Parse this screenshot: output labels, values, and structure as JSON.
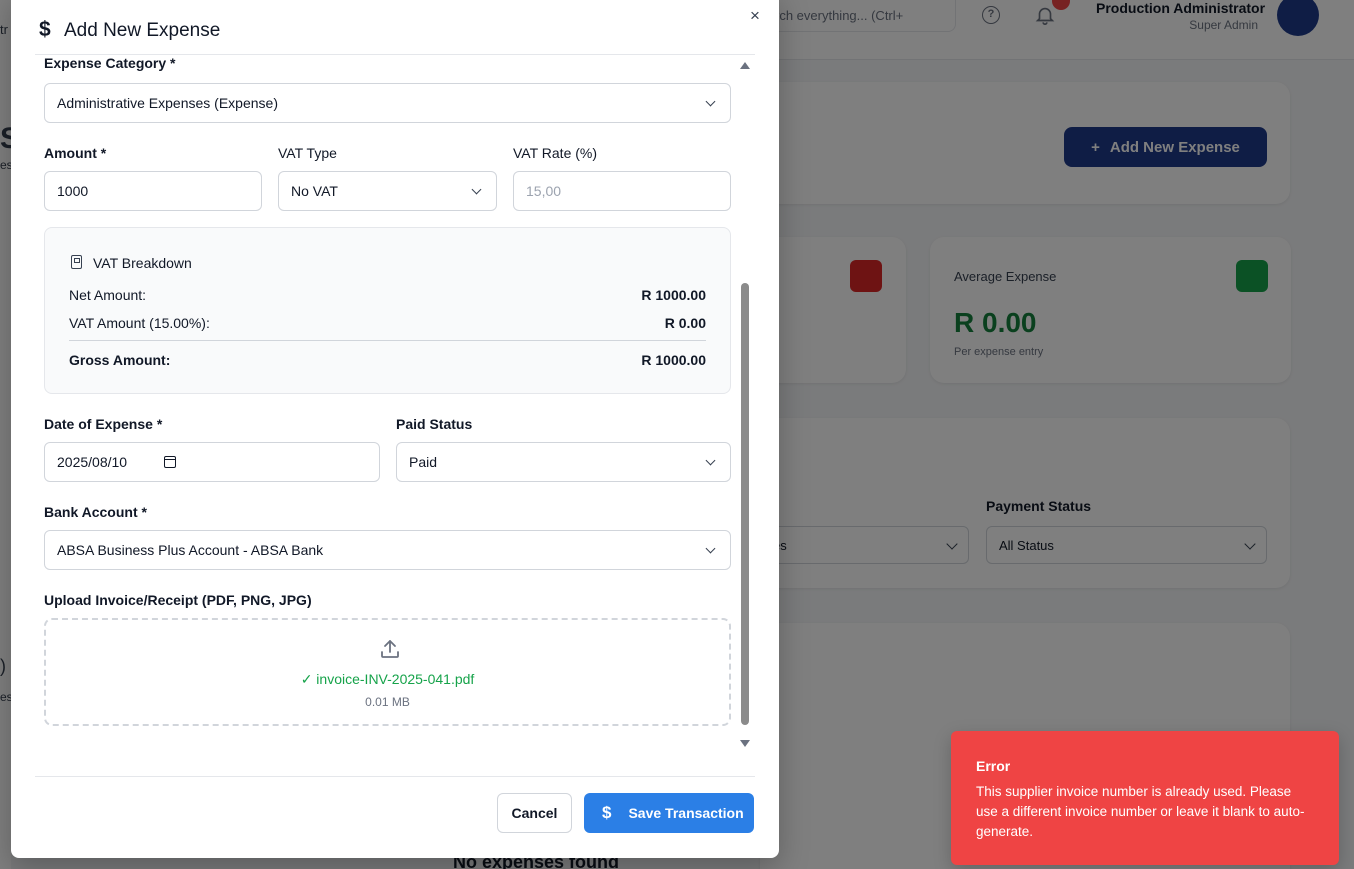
{
  "background": {
    "left_text_top": "tr",
    "left_text_mid": "S",
    "left_text_mid2": "es",
    "left_text_low": ")",
    "left_text_low2": "es",
    "search_placeholder": "rch everything... (Ctrl+",
    "user_name": "Production Administrator",
    "user_role": "Super Admin",
    "add_button_label": "Add New Expense",
    "stat_average_label": "Average Expense",
    "stat_average_value": "R 0.00",
    "stat_average_sub": "Per expense entry",
    "payment_status_label": "Payment Status",
    "payment_status_value": "All Status",
    "category_filter_value": "es",
    "empty_state": "No expenses found"
  },
  "modal": {
    "title": "Add New Expense",
    "close_label": "×",
    "expense_category_label": "Expense Category *",
    "expense_category_value": "Administrative Expenses (Expense)",
    "amount_label": "Amount *",
    "amount_value": "1000",
    "vat_type_label": "VAT Type",
    "vat_type_value": "No VAT",
    "vat_rate_label": "VAT Rate (%)",
    "vat_rate_value": "15,00",
    "vat_breakdown": {
      "title": "VAT Breakdown",
      "net_label": "Net Amount:",
      "net_value": "R 1000.00",
      "vat_label": "VAT Amount (15.00%):",
      "vat_value": "R 0.00",
      "gross_label": "Gross Amount:",
      "gross_value": "R 1000.00"
    },
    "date_label": "Date of Expense *",
    "date_value": "2025/08/10",
    "paid_status_label": "Paid Status",
    "paid_status_value": "Paid",
    "bank_account_label": "Bank Account *",
    "bank_account_value": "ABSA Business Plus Account - ABSA Bank",
    "upload_label": "Upload Invoice/Receipt (PDF, PNG, JPG)",
    "upload_file": "✓ invoice-INV-2025-041.pdf",
    "upload_size": "0.01 MB",
    "cancel_label": "Cancel",
    "save_label": "Save Transaction"
  },
  "toast": {
    "title": "Error",
    "message": "This supplier invoice number is already used. Please use a different invoice number or leave it blank to auto-generate."
  },
  "colors": {
    "primary": "#2b7fe6",
    "error": "#ef4444",
    "success": "#16a34a",
    "brand_dark": "#1e3a8a"
  }
}
